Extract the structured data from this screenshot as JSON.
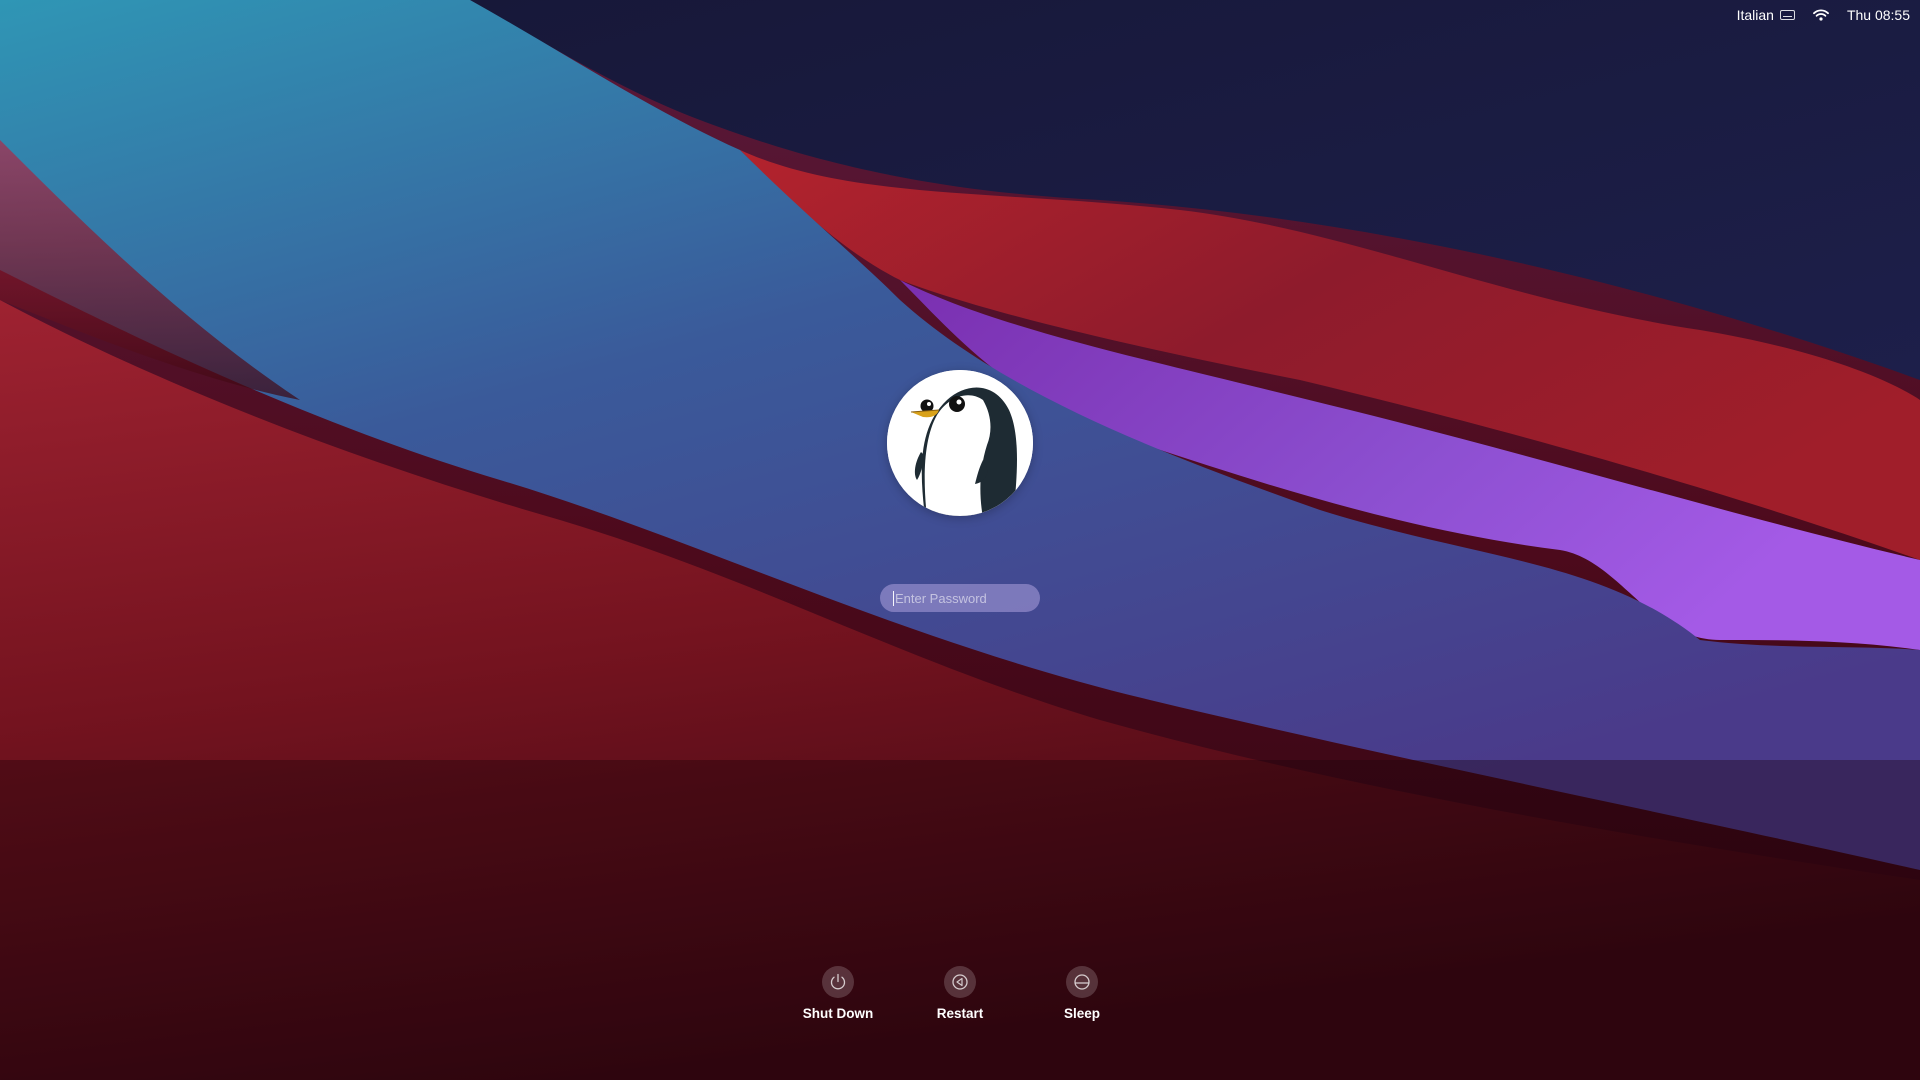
{
  "menubar": {
    "input_language": "Italian",
    "keyboard_icon": "keyboard-icon",
    "wifi_icon": "wifi-icon",
    "clock": "Thu 08:55"
  },
  "login": {
    "avatar_icon": "penguin-avatar",
    "username": "",
    "password_placeholder": "Enter Password"
  },
  "actions": [
    {
      "label": "Shut Down",
      "icon": "power-icon"
    },
    {
      "label": "Restart",
      "icon": "restart-icon"
    },
    {
      "label": "Sleep",
      "icon": "sleep-icon"
    }
  ],
  "colors": {
    "wallpaper_dark_navy": "#1a1a3e",
    "wallpaper_teal": "#2f8fb3",
    "wallpaper_purple": "#8e44cf",
    "wallpaper_red": "#a5202c",
    "wallpaper_deep_red": "#3a0712"
  }
}
